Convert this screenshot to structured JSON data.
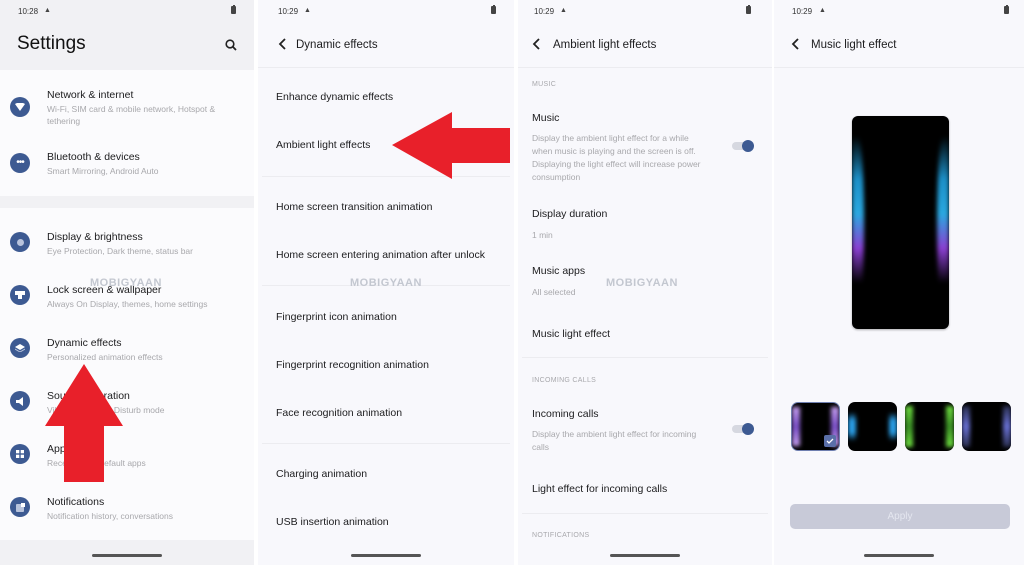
{
  "screens": {
    "settings": {
      "status_time": "10:28",
      "title": "Settings",
      "search_icon": "search-icon",
      "items": [
        {
          "label": "Network & internet",
          "sub": "Wi-Fi, SIM card & mobile network, Hotspot & tethering",
          "icon": "wifi-icon"
        },
        {
          "label": "Bluetooth & devices",
          "sub": "Smart Mirroring, Android Auto",
          "icon": "more-dots-icon"
        },
        {
          "label": "Display & brightness",
          "sub": "Eye Protection, Dark theme, status bar",
          "icon": "display-icon"
        },
        {
          "label": "Lock screen & wallpaper",
          "sub": "Always On Display, themes, home settings",
          "icon": "lock-screen-icon"
        },
        {
          "label": "Dynamic effects",
          "sub": "Personalized animation effects",
          "icon": "layers-icon"
        },
        {
          "label": "Sound & vibration",
          "sub": "Vibration, Do Not Disturb mode",
          "icon": "speaker-icon"
        },
        {
          "label": "Apps",
          "sub": "Recent apps, default apps",
          "icon": "apps-grid-icon"
        },
        {
          "label": "Notifications",
          "sub": "Notification history, conversations",
          "icon": "notification-icon"
        }
      ]
    },
    "dynamic_effects": {
      "status_time": "10:29",
      "title": "Dynamic effects",
      "items": [
        "Enhance dynamic effects",
        "Ambient light effects",
        "Home screen transition animation",
        "Home screen entering animation after unlock",
        "Fingerprint icon animation",
        "Fingerprint recognition animation",
        "Face recognition animation",
        "Charging animation",
        "USB insertion animation"
      ]
    },
    "ambient_light": {
      "status_time": "10:29",
      "title": "Ambient light effects",
      "section_music": "MUSIC",
      "music": {
        "title": "Music",
        "sub": "Display the ambient light effect for a while when music is playing and the screen is off. Displaying the light effect will increase power consumption",
        "enabled": true
      },
      "display_duration": {
        "title": "Display duration",
        "value": "1 min"
      },
      "music_apps": {
        "title": "Music apps",
        "value": "All selected"
      },
      "music_light_effect": "Music light effect",
      "section_calls": "INCOMING CALLS",
      "incoming_calls": {
        "title": "Incoming calls",
        "sub": "Display the ambient light effect for incoming calls",
        "enabled": true
      },
      "light_effect_calls": "Light effect for incoming calls",
      "section_notifications": "NOTIFICATIONS"
    },
    "music_light_effect": {
      "status_time": "10:29",
      "title": "Music light effect",
      "options": [
        {
          "name": "purple-wave",
          "selected": true,
          "color": "#9a6fe0"
        },
        {
          "name": "blue-bokeh",
          "selected": false,
          "color": "#2a9fe8"
        },
        {
          "name": "green-bokeh",
          "selected": false,
          "color": "#5fd13a"
        },
        {
          "name": "indigo-bokeh",
          "selected": false,
          "color": "#5a64c8"
        }
      ],
      "apply_label": "Apply"
    }
  },
  "watermark": "MOBIGYAAN",
  "colors": {
    "accent": "#3d5a92",
    "arrow": "#e8202a",
    "apply_disabled": "#c8cad8"
  }
}
